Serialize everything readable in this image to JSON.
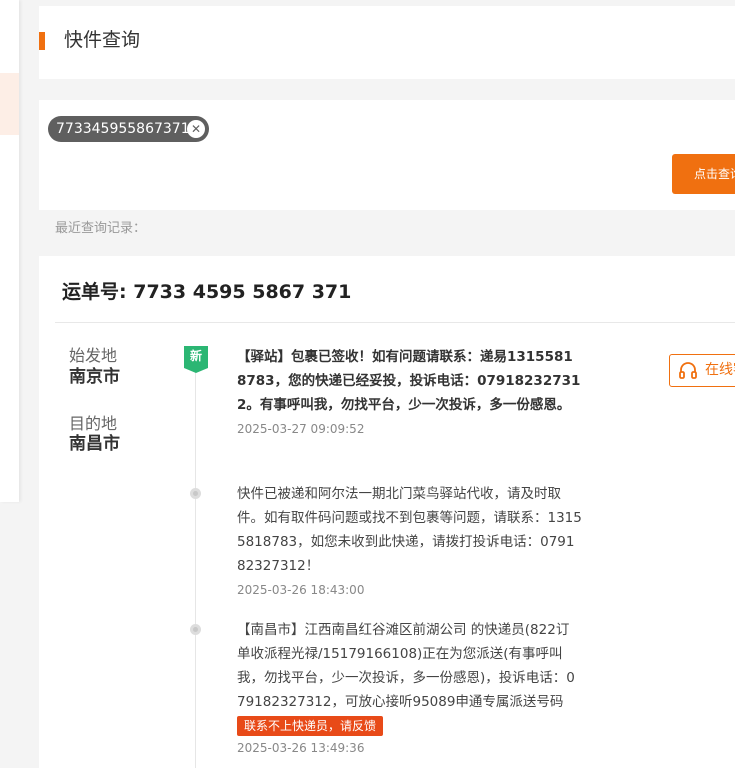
{
  "page": {
    "title": "快件查询"
  },
  "query": {
    "tracking_chip": "773345955867371",
    "clear_glyph": "✕",
    "button_label": "点击查询",
    "recent_label": "最近查询记录："
  },
  "result": {
    "waybill_label": "运单号",
    "waybill_number": ": 7733 4595 5867 371",
    "origin_label": "始发地",
    "origin_city": "南京市",
    "destination_label": "目的地",
    "destination_city": "南昌市",
    "new_badge": "新",
    "online_button": "在线客服",
    "events": [
      {
        "text": "【驿站】包裹已签收！如有问题请联系：递易13155818783，您的快递已经妥投，投诉电话：079182327312。有事呼叫我，勿找平台，少一次投诉，多一份感恩。",
        "time": "2025-03-27 09:09:52"
      },
      {
        "text": "快件已被递和阿尔法一期北门菜鸟驿站代收，请及时取件。如有取件码问题或找不到包裹等问题，请联系：13155818783，如您未收到此快递，请拨打投诉电话：079182327312！",
        "time": "2025-03-26 18:43:00"
      },
      {
        "text": "【南昌市】江西南昌红谷滩区前湖公司 的快递员(822订单收派程光禄/15179166108)正在为您派送(有事呼叫我，勿找平台，少一次投诉，多一份感恩)，投诉电话：079182327312，可放心接听95089申通专属派送号码",
        "feedback": "联系不上快递员，请反馈",
        "time": "2025-03-26 13:49:36"
      }
    ]
  },
  "colors": {
    "accent": "#f07010",
    "new_badge": "#2bb673",
    "feedback": "#e84a18",
    "chip": "#5f5f5f"
  },
  "icons": {
    "header_marker": "orange-bar",
    "clear": "close-icon",
    "online_service": "headset-icon",
    "timeline_node": "dot-icon"
  }
}
